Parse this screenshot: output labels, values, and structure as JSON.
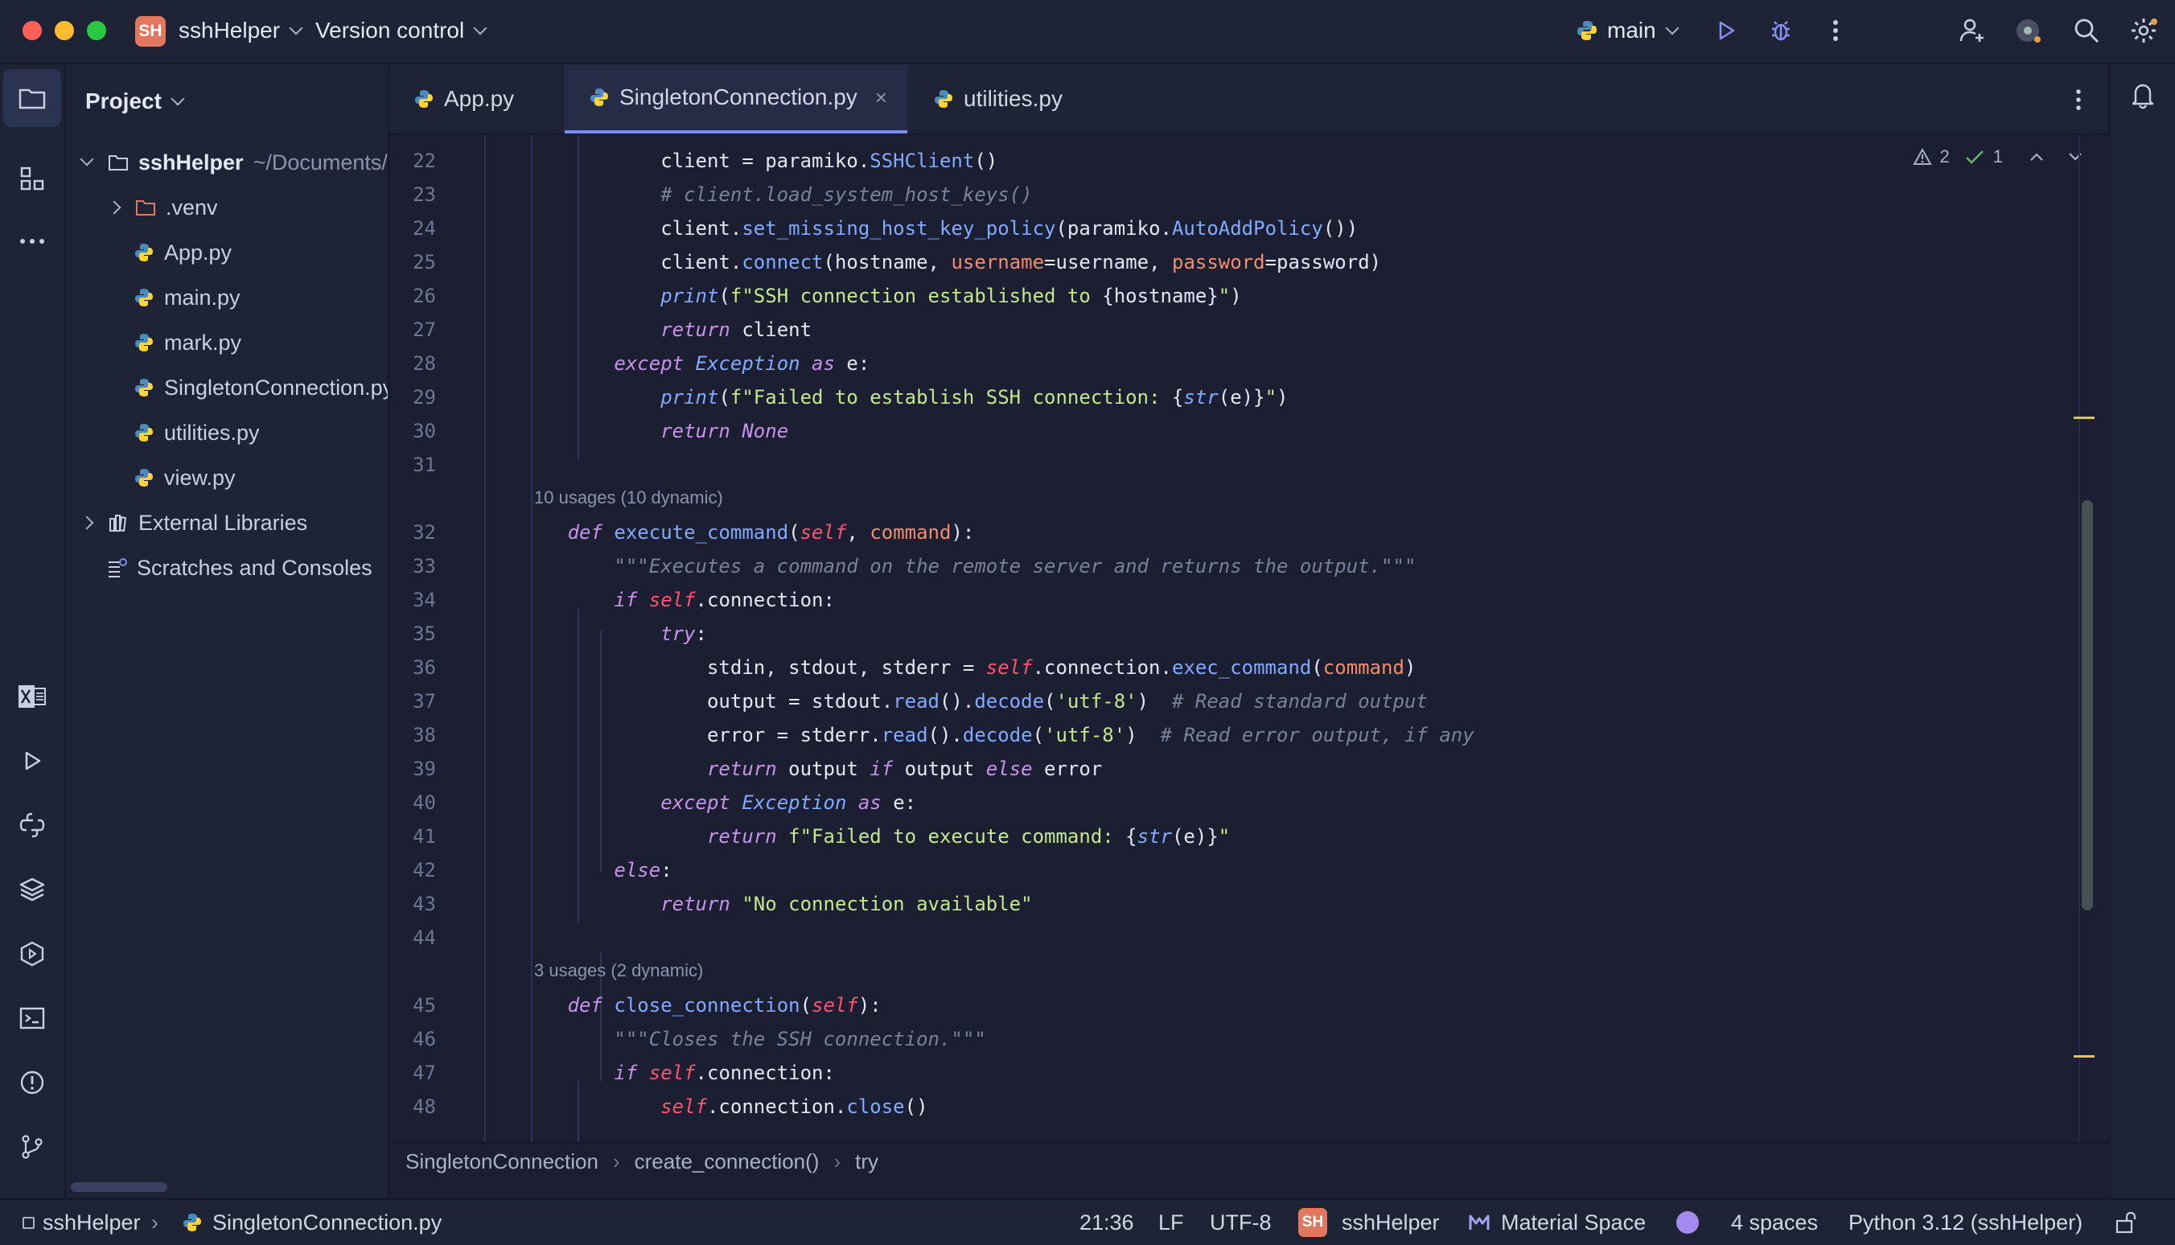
{
  "titlebar": {
    "project_badge": "SH",
    "project_name": "sshHelper",
    "vcs": "Version control",
    "branch": "main"
  },
  "project_panel": {
    "title": "Project",
    "tree": [
      {
        "label": "sshHelper",
        "suffix": "~/Documents/",
        "type": "folder",
        "expanded": true
      },
      {
        "label": ".venv",
        "type": "folder",
        "expanded": false
      },
      {
        "label": "App.py",
        "type": "py"
      },
      {
        "label": "main.py",
        "type": "py"
      },
      {
        "label": "mark.py",
        "type": "py"
      },
      {
        "label": "SingletonConnection.py",
        "type": "py"
      },
      {
        "label": "utilities.py",
        "type": "py"
      },
      {
        "label": "view.py",
        "type": "py"
      },
      {
        "label": "External Libraries",
        "type": "lib"
      },
      {
        "label": "Scratches and Consoles",
        "type": "scratch"
      }
    ]
  },
  "tabs": [
    {
      "label": "App.py",
      "active": false
    },
    {
      "label": "SingletonConnection.py",
      "active": true,
      "close": "×"
    },
    {
      "label": "utilities.py",
      "active": false
    }
  ],
  "inspections": {
    "warnings": "2",
    "ok": "1"
  },
  "editor": {
    "line_numbers": [
      "22",
      "23",
      "24",
      "25",
      "26",
      "27",
      "28",
      "29",
      "30",
      "31",
      "32",
      "33",
      "34",
      "35",
      "36",
      "37",
      "38",
      "39",
      "40",
      "41",
      "42",
      "43",
      "44",
      "45",
      "46",
      "47",
      "48"
    ],
    "usage_hint_1": "10 usages (10 dynamic)",
    "usage_hint_2": "3 usages (2 dynamic)"
  },
  "breadcrumbs": [
    "SingletonConnection",
    "create_connection()",
    "try"
  ],
  "statusbar": {
    "project": "sshHelper",
    "file": "SingletonConnection.py",
    "position": "21:36",
    "line_sep": "LF",
    "encoding": "UTF-8",
    "badge": "SH",
    "project2": "sshHelper",
    "theme": "Material Space",
    "indent": "4 spaces",
    "interpreter": "Python 3.12 (sshHelper)"
  },
  "colors": {
    "accent": "#7b8cf0",
    "background": "#1b1f31",
    "badge": "#e0775e"
  }
}
